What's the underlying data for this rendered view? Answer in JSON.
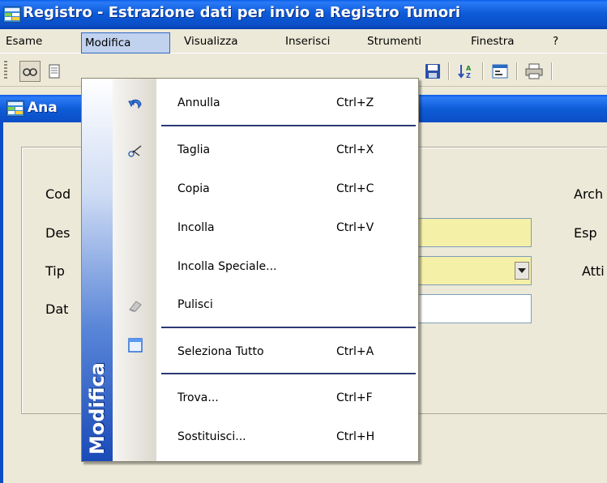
{
  "window": {
    "title": "Registro - Estrazione dati per invio a Registro Tumori"
  },
  "menubar": {
    "items": [
      {
        "label": "Esame"
      },
      {
        "label": "Modifica",
        "active": true
      },
      {
        "label": "Visualizza"
      },
      {
        "label": "Inserisci"
      },
      {
        "label": "Strumenti"
      },
      {
        "label": "Finestra"
      },
      {
        "label": "?"
      }
    ]
  },
  "toolbar": {
    "icons": [
      "view-icon",
      "document-icon",
      "save-icon",
      "sort-az-icon",
      "properties-icon",
      "print-icon"
    ]
  },
  "inner_window": {
    "title": "Ana"
  },
  "form": {
    "labels": {
      "cod": "Cod",
      "des": "Des",
      "tip": "Tip",
      "dat": "Dat",
      "arch": "Arch",
      "esp": "Esp",
      "att": "Atti"
    }
  },
  "dropdown": {
    "band_label": "Modifica",
    "items": [
      {
        "label": "Annulla",
        "shortcut": "Ctrl+Z",
        "icon": "undo-icon"
      },
      {
        "label": "Taglia",
        "shortcut": "Ctrl+X",
        "icon": "scissors-icon"
      },
      {
        "label": "Copia",
        "shortcut": "Ctrl+C",
        "icon": ""
      },
      {
        "label": "Incolla",
        "shortcut": "Ctrl+V",
        "icon": ""
      },
      {
        "label": "Incolla Speciale...",
        "shortcut": "",
        "icon": ""
      },
      {
        "label": "Pulisci",
        "shortcut": "",
        "icon": "eraser-icon"
      },
      {
        "label": "Seleziona Tutto",
        "shortcut": "Ctrl+A",
        "icon": "select-all-icon"
      },
      {
        "label": "Trova...",
        "shortcut": "Ctrl+F",
        "icon": ""
      },
      {
        "label": "Sostituisci...",
        "shortcut": "Ctrl+H",
        "icon": ""
      }
    ]
  },
  "colors": {
    "titlebar": "#0a4fc8",
    "menu_highlight": "#c1d2ee",
    "field_yellow": "#f5f0a8",
    "separator": "#2c3a74"
  }
}
